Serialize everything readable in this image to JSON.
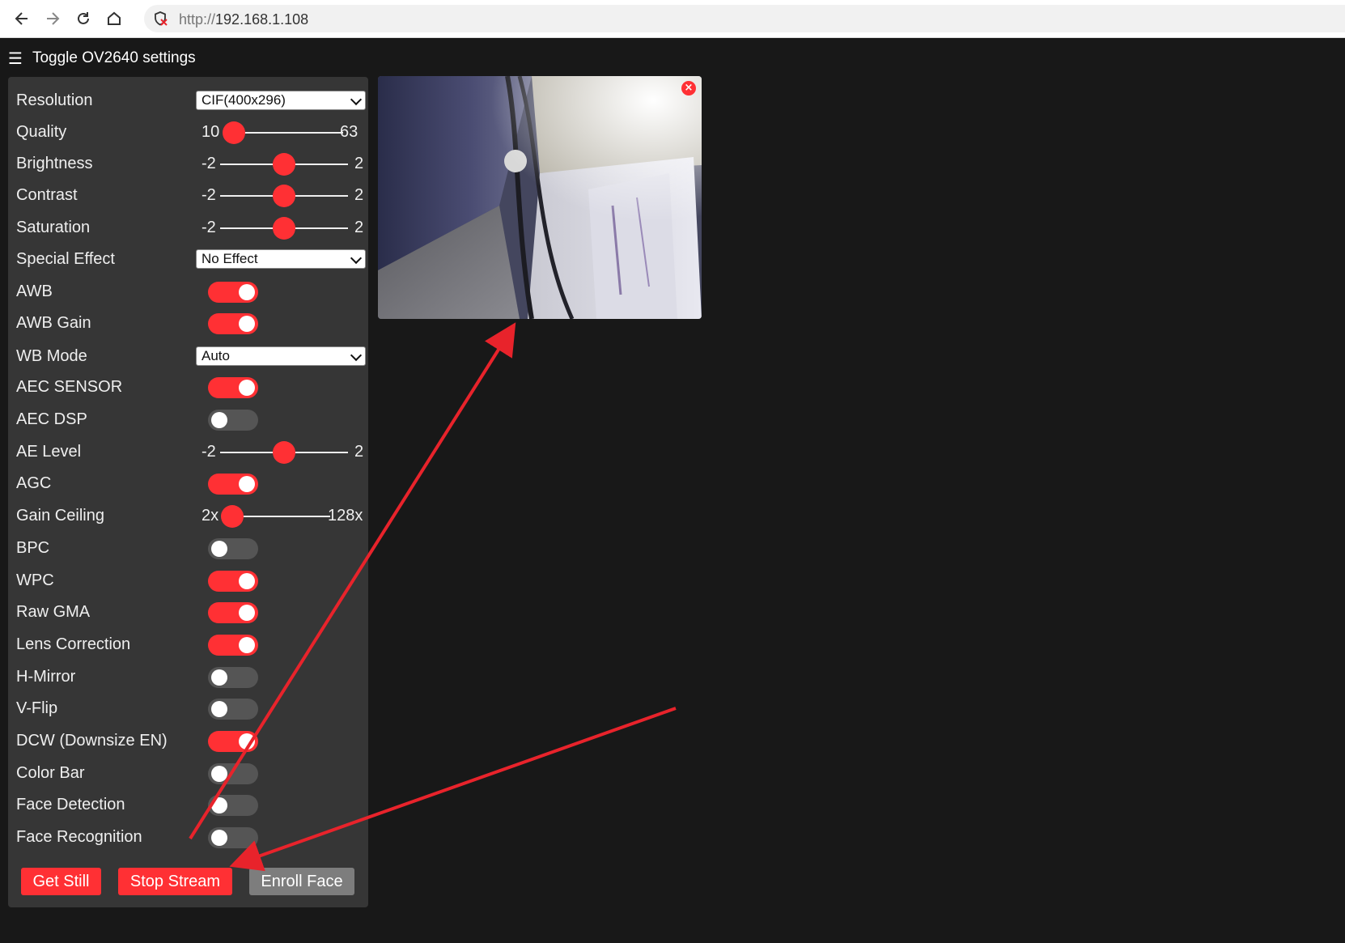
{
  "browser": {
    "url_scheme": "http://",
    "url_host": "192.168.1.108"
  },
  "header": {
    "toggle_label": "Toggle OV2640 settings"
  },
  "settings": {
    "resolution": {
      "label": "Resolution",
      "value": "CIF(400x296)"
    },
    "quality": {
      "label": "Quality",
      "min": "10",
      "max": "63",
      "value": 10
    },
    "brightness": {
      "label": "Brightness",
      "min": "-2",
      "max": "2",
      "value": 0
    },
    "contrast": {
      "label": "Contrast",
      "min": "-2",
      "max": "2",
      "value": 0
    },
    "saturation": {
      "label": "Saturation",
      "min": "-2",
      "max": "2",
      "value": 0
    },
    "special_effect": {
      "label": "Special Effect",
      "value": "No Effect"
    },
    "awb": {
      "label": "AWB",
      "on": true
    },
    "awb_gain": {
      "label": "AWB Gain",
      "on": true
    },
    "wb_mode": {
      "label": "WB Mode",
      "value": "Auto"
    },
    "aec_sensor": {
      "label": "AEC SENSOR",
      "on": true
    },
    "aec_dsp": {
      "label": "AEC DSP",
      "on": false
    },
    "ae_level": {
      "label": "AE Level",
      "min": "-2",
      "max": "2",
      "value": 0
    },
    "agc": {
      "label": "AGC",
      "on": true
    },
    "gain_ceiling": {
      "label": "Gain Ceiling",
      "min": "2x",
      "max": "128x",
      "value": 0
    },
    "bpc": {
      "label": "BPC",
      "on": false
    },
    "wpc": {
      "label": "WPC",
      "on": true
    },
    "raw_gma": {
      "label": "Raw GMA",
      "on": true
    },
    "lens_correction": {
      "label": "Lens Correction",
      "on": true
    },
    "h_mirror": {
      "label": "H-Mirror",
      "on": false
    },
    "v_flip": {
      "label": "V-Flip",
      "on": false
    },
    "dcw": {
      "label": "DCW (Downsize EN)",
      "on": true
    },
    "color_bar": {
      "label": "Color Bar",
      "on": false
    },
    "face_detection": {
      "label": "Face Detection",
      "on": false
    },
    "face_recognition": {
      "label": "Face Recognition",
      "on": false
    }
  },
  "buttons": {
    "get_still": "Get Still",
    "stop_stream": "Stop Stream",
    "enroll_face": "Enroll Face"
  },
  "stream": {
    "close_glyph": "×"
  },
  "colors": {
    "accent": "#ff3034",
    "panel": "#363636",
    "background": "#181818",
    "annotation_arrow": "#e8232b"
  }
}
